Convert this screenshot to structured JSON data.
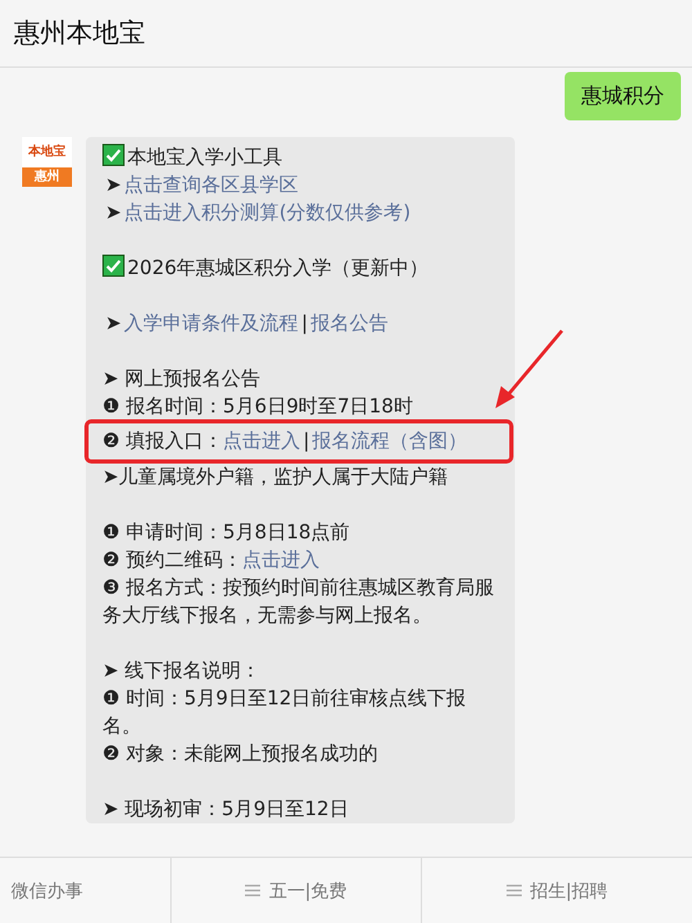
{
  "header": {
    "title": "惠州本地宝"
  },
  "sent_message": {
    "text": "惠城积分"
  },
  "avatar": {
    "top_text": "本地宝",
    "bottom_text": "惠州"
  },
  "message_lines": [
    {
      "kind": "check",
      "parts": [
        {
          "kind": "text",
          "text": "本地宝入学小工具"
        }
      ]
    },
    {
      "kind": "plain",
      "parts": [
        {
          "kind": "text",
          "text": "➤"
        },
        {
          "kind": "link",
          "text": "点击查询各区县学区"
        }
      ]
    },
    {
      "kind": "plain",
      "parts": [
        {
          "kind": "text",
          "text": "➤"
        },
        {
          "kind": "link",
          "text": "点击进入积分测算(分数仅供参考)"
        }
      ]
    },
    {
      "kind": "blank"
    },
    {
      "kind": "check",
      "parts": [
        {
          "kind": "text",
          "text": "2026年惠城区积分入学（更新中）"
        }
      ]
    },
    {
      "kind": "blank"
    },
    {
      "kind": "plain",
      "parts": [
        {
          "kind": "text",
          "text": "➤"
        },
        {
          "kind": "link",
          "text": "入学申请条件及流程"
        },
        {
          "kind": "text",
          "text": "|"
        },
        {
          "kind": "link",
          "text": "报名公告"
        }
      ]
    },
    {
      "kind": "blank"
    },
    {
      "kind": "plain",
      "parts": [
        {
          "kind": "text",
          "text": "➤ 网上预报名公告"
        }
      ]
    },
    {
      "kind": "plain",
      "parts": [
        {
          "kind": "text",
          "text": "❶ 报名时间：5月6日9时至7日18时"
        }
      ]
    },
    {
      "kind": "highlight",
      "parts": [
        {
          "kind": "text",
          "text": "❷ 填报入口："
        },
        {
          "kind": "link",
          "text": "点击进入"
        },
        {
          "kind": "text",
          "text": "|"
        },
        {
          "kind": "link",
          "text": "报名流程（含图）"
        }
      ]
    },
    {
      "kind": "plain",
      "parts": [
        {
          "kind": "text",
          "text": "➤儿童属境外户籍，监护人属于大陆户籍"
        }
      ]
    },
    {
      "kind": "blank"
    },
    {
      "kind": "plain",
      "parts": [
        {
          "kind": "text",
          "text": "❶ 申请时间：5月8日18点前"
        }
      ]
    },
    {
      "kind": "plain",
      "parts": [
        {
          "kind": "text",
          "text": "❷ 预约二维码："
        },
        {
          "kind": "link",
          "text": "点击进入"
        }
      ]
    },
    {
      "kind": "plain",
      "parts": [
        {
          "kind": "text",
          "text": "❸ 报名方式：按预约时间前往惠城区教育局服务大厅线下报名，无需参与网上报名。"
        }
      ]
    },
    {
      "kind": "blank"
    },
    {
      "kind": "plain",
      "parts": [
        {
          "kind": "text",
          "text": "➤ 线下报名说明："
        }
      ]
    },
    {
      "kind": "plain",
      "parts": [
        {
          "kind": "text",
          "text": "❶ 时间：5月9日至12日前往审核点线下报名。"
        }
      ]
    },
    {
      "kind": "plain",
      "parts": [
        {
          "kind": "text",
          "text": "❷ 对象：未能网上预报名成功的"
        }
      ]
    },
    {
      "kind": "blank"
    },
    {
      "kind": "plain",
      "parts": [
        {
          "kind": "text",
          "text": "➤ 现场初审：5月9日至12日"
        }
      ]
    }
  ],
  "bottom_menu": [
    {
      "label": "微信办事",
      "has_menu_icon": false
    },
    {
      "label": "五一|免费",
      "has_menu_icon": true
    },
    {
      "label": "招生|招聘",
      "has_menu_icon": true
    }
  ]
}
